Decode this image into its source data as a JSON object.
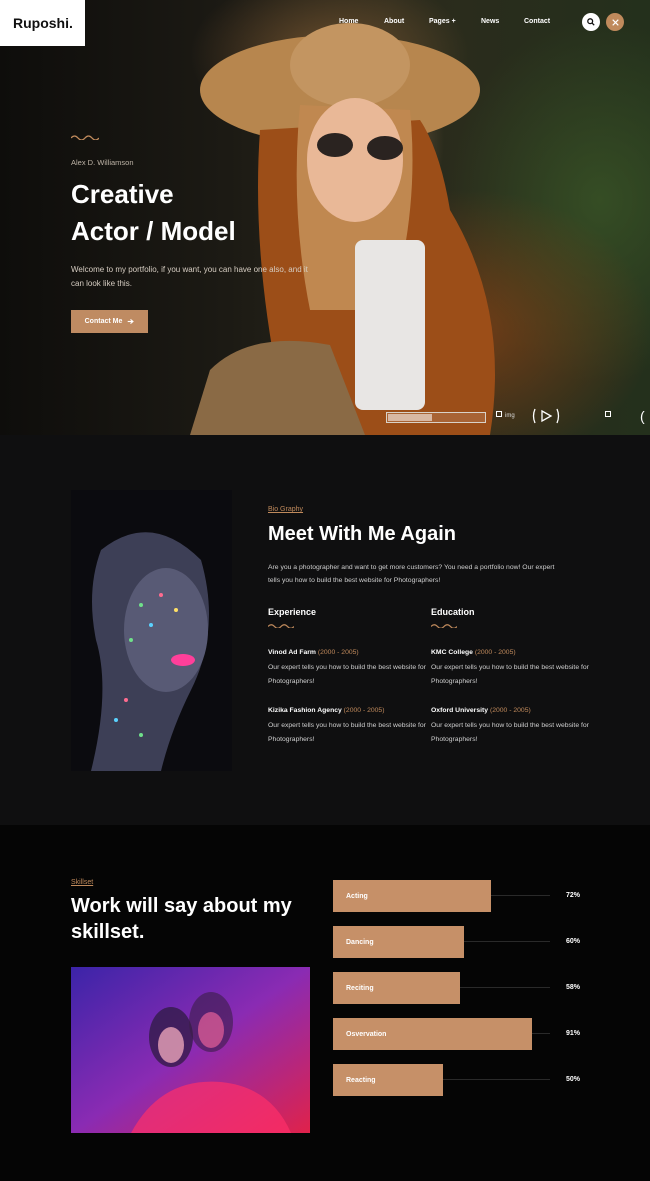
{
  "brand": {
    "logo": "Ruposhi."
  },
  "nav": {
    "items": [
      "Home",
      "About",
      "Pages +",
      "News",
      "Contact"
    ],
    "search_icon": "search-icon",
    "close_icon": "close-icon"
  },
  "hero": {
    "name": "Alex D. Williamson",
    "title_line1": "Creative",
    "title_line2": "Actor / Model",
    "description": "Welcome to my portfolio, if you want, you can have one also, and it can look like this.",
    "button_label": "Contact Me",
    "slider_img_label": "img"
  },
  "about": {
    "eyebrow": "Bio Graphy",
    "title": "Meet With Me Again",
    "description": "Are you a photographer and want to get more customers? You need a portfolio now! Our expert tells you how to build the best website for Photographers!",
    "experience": {
      "heading": "Experience",
      "entries": [
        {
          "title": "Vinod Ad Farm",
          "years": "(2000 - 2005)",
          "text": "Our expert tells you how to build the best website for Photographers!"
        },
        {
          "title": "Kizika Fashion Agency",
          "years": "(2000 - 2005)",
          "text": "Our expert tells you how to build the best website for Photographers!"
        }
      ]
    },
    "education": {
      "heading": "Education",
      "entries": [
        {
          "title": "KMC College",
          "years": "(2000 - 2005)",
          "text": "Our expert tells you how to build the best website for Photographers!"
        },
        {
          "title": "Oxford University",
          "years": "(2000 - 2005)",
          "text": "Our expert tells you how to build the best website for Photographers!"
        }
      ]
    }
  },
  "skills": {
    "eyebrow": "Skillset",
    "title": "Work will say about my skillset.",
    "bars": [
      {
        "label": "Acting",
        "value": 72,
        "percent_label": "72%"
      },
      {
        "label": "Dancing",
        "value": 60,
        "percent_label": "60%"
      },
      {
        "label": "Reciting",
        "value": 58,
        "percent_label": "58%"
      },
      {
        "label": "Osvervation",
        "value": 91,
        "percent_label": "91%"
      },
      {
        "label": "Reacting",
        "value": 50,
        "percent_label": "50%"
      }
    ]
  },
  "colors": {
    "accent": "#c08a5c",
    "bar": "#c69068",
    "background": "#0f0f10"
  }
}
